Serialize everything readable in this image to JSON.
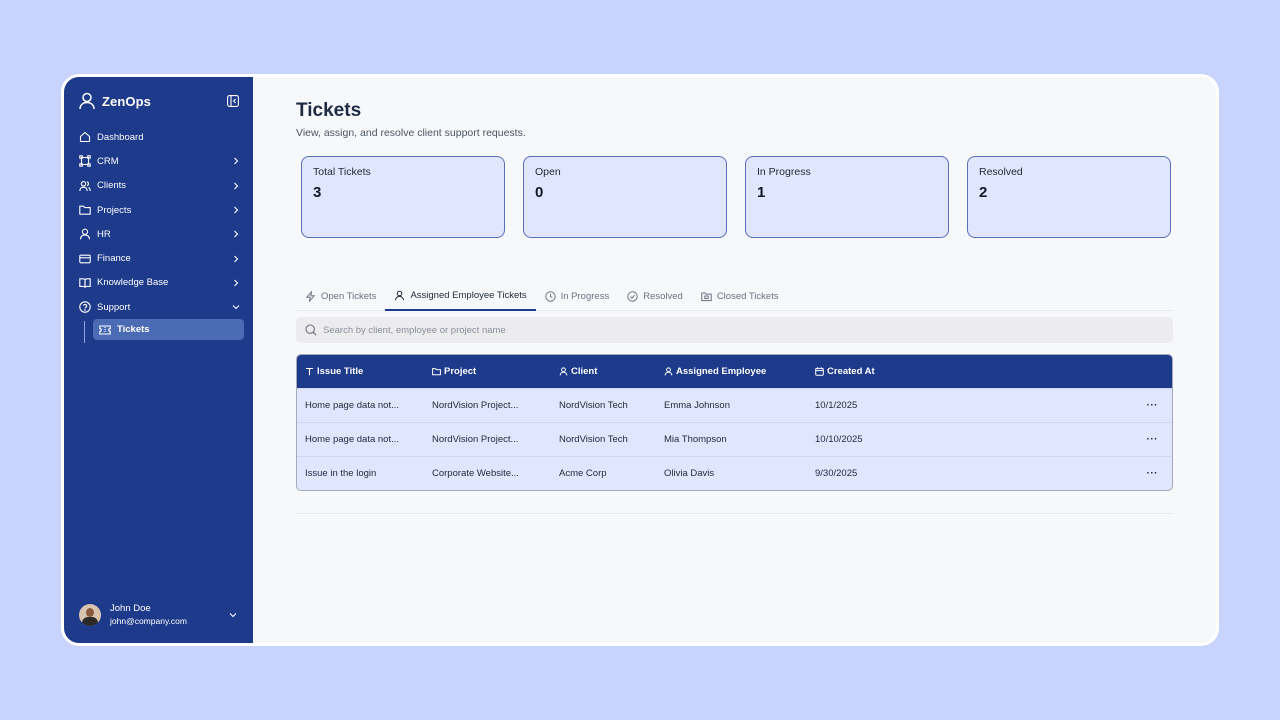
{
  "app": {
    "name": "ZenOps"
  },
  "sidebar": {
    "items": [
      {
        "label": "Dashboard",
        "icon": "home-icon",
        "has_chevron": false
      },
      {
        "label": "CRM",
        "icon": "crm-icon",
        "has_chevron": true
      },
      {
        "label": "Clients",
        "icon": "users-icon",
        "has_chevron": true
      },
      {
        "label": "Projects",
        "icon": "folder-icon",
        "has_chevron": true
      },
      {
        "label": "HR",
        "icon": "user-icon",
        "has_chevron": true
      },
      {
        "label": "Finance",
        "icon": "card-icon",
        "has_chevron": true
      },
      {
        "label": "Knowledge Base",
        "icon": "book-icon",
        "has_chevron": true
      },
      {
        "label": "Support",
        "icon": "help-icon",
        "has_chevron": true,
        "expanded": true
      }
    ],
    "sub_items": [
      {
        "label": "Tickets",
        "icon": "ticket-icon",
        "active": true
      }
    ],
    "user": {
      "name": "John Doe",
      "email": "john@company.com"
    }
  },
  "page": {
    "title": "Tickets",
    "subtitle": "View, assign, and resolve client support requests."
  },
  "stats": [
    {
      "label": "Total Tickets",
      "value": "3"
    },
    {
      "label": "Open",
      "value": "0"
    },
    {
      "label": "In Progress",
      "value": "1"
    },
    {
      "label": "Resolved",
      "value": "2"
    }
  ],
  "tabs": [
    {
      "label": "Open Tickets",
      "icon": "bolt-icon",
      "active": false
    },
    {
      "label": "Assigned Employee Tickets",
      "icon": "user-icon",
      "active": true
    },
    {
      "label": "In Progress",
      "icon": "clock-icon",
      "active": false
    },
    {
      "label": "Resolved",
      "icon": "check-circle-icon",
      "active": false
    },
    {
      "label": "Closed Tickets",
      "icon": "archive-icon",
      "active": false
    }
  ],
  "search": {
    "placeholder": "Search by client, employee or project name",
    "value": ""
  },
  "table": {
    "columns": [
      {
        "label": "Issue Title",
        "icon": "text-icon"
      },
      {
        "label": "Project",
        "icon": "folder-icon"
      },
      {
        "label": "Client",
        "icon": "user-icon"
      },
      {
        "label": "Assigned Employee",
        "icon": "user-icon"
      },
      {
        "label": "Created At",
        "icon": "calendar-icon"
      }
    ],
    "rows": [
      [
        "Home page data not...",
        "NordVision Project...",
        "NordVision Tech",
        "Emma Johnson",
        "10/1/2025"
      ],
      [
        "Home page data not...",
        "NordVision Project...",
        "NordVision Tech",
        "Mia Thompson",
        "10/10/2025"
      ],
      [
        "Issue in the login",
        "Corporate Website...",
        "Acme Corp",
        "Olivia Davis",
        "9/30/2025"
      ]
    ],
    "row_action": "···"
  },
  "colors": {
    "primary": "#1e3a8a",
    "card_bg": "#dfe6fd",
    "page_bg": "#c8d4fb"
  }
}
